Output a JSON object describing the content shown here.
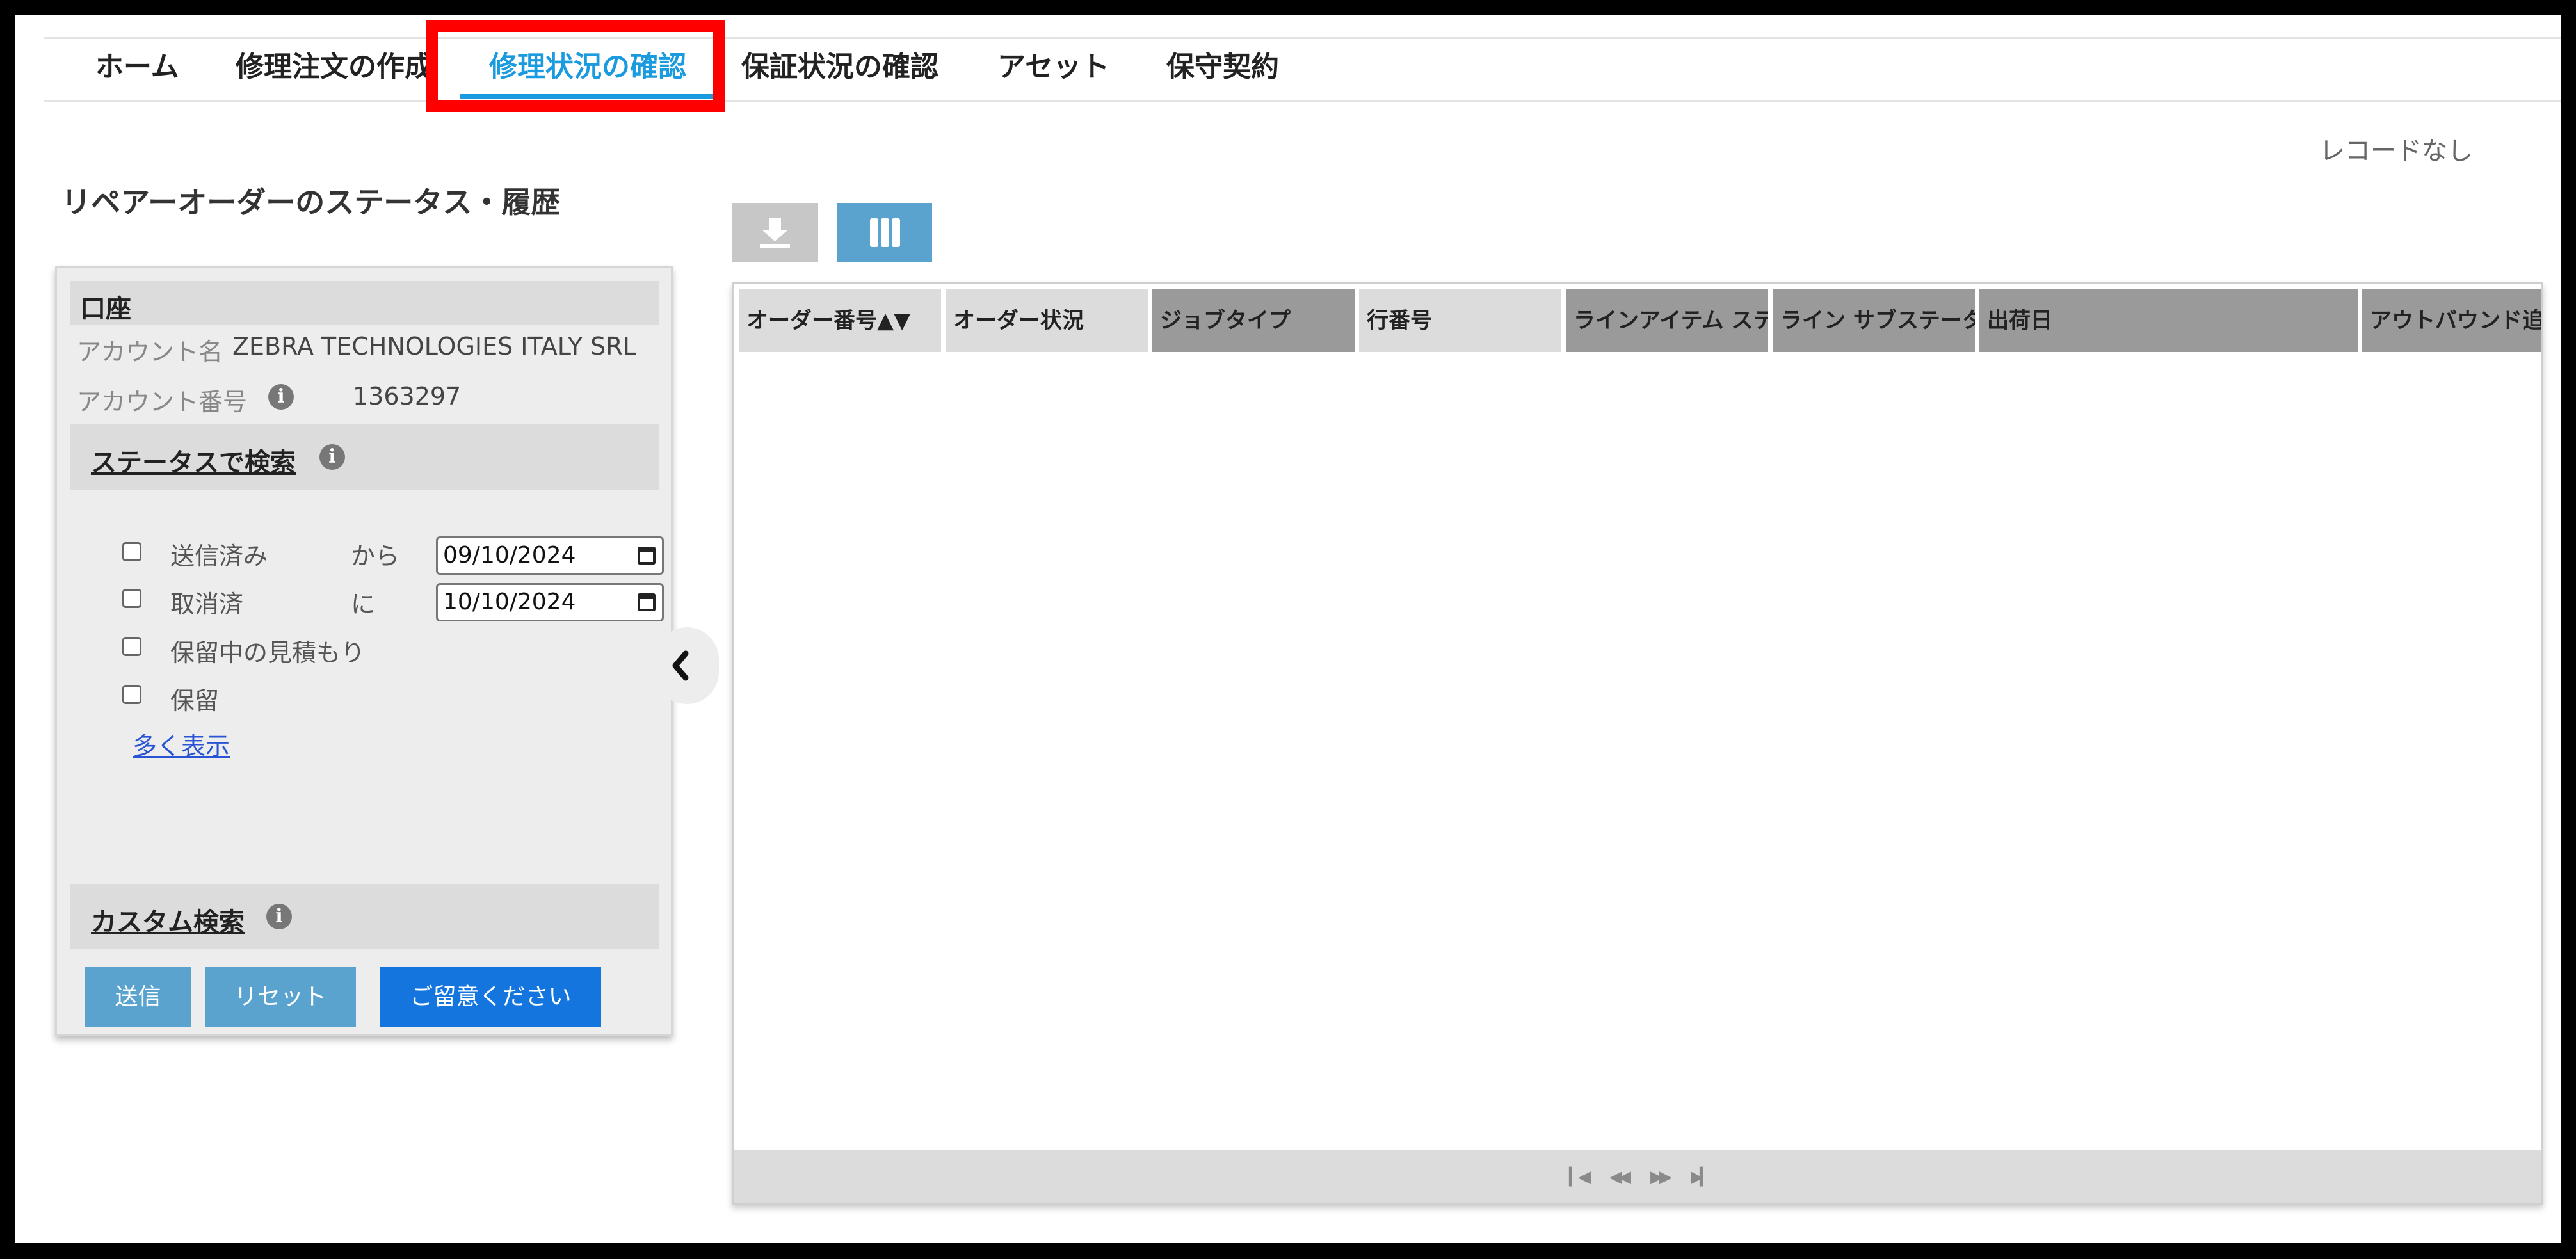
{
  "nav": {
    "items": [
      {
        "label": "ホーム"
      },
      {
        "label": "修理注文の作成"
      },
      {
        "label": "修理状況の確認",
        "active": true
      },
      {
        "label": "保証状況の確認"
      },
      {
        "label": "アセット"
      },
      {
        "label": "保守契約"
      }
    ]
  },
  "page": {
    "title": "リペアーオーダーのステータス・履歴",
    "record_count": "レコードなし"
  },
  "account": {
    "header": "口座",
    "name_label": "アカウント名",
    "name_value": "ZEBRA TECHNOLOGIES ITALY SRL",
    "number_label": "アカウント番号",
    "number_value": "1363297"
  },
  "status_search": {
    "header": "ステータスで検索",
    "checkboxes": [
      "送信済み",
      "取消済",
      "保留中の見積もり",
      "保留"
    ],
    "from_label": "から",
    "to_label": "に",
    "from_date": "09/10/2024",
    "to_date": "10/10/2024",
    "show_more": "多く表示"
  },
  "custom_search": {
    "header": "カスタム検索"
  },
  "buttons": {
    "submit": "送信",
    "reset": "リセット",
    "notice": "ご留意ください"
  },
  "grid": {
    "columns": [
      "オーダー番号▲▼",
      "オーダー状況",
      "ジョブタイプ",
      "行番号",
      "ラインアイテム ステ",
      "ライン サブステータ",
      "出荷日",
      "アウトバウンド追跡"
    ],
    "rows": []
  },
  "colors": {
    "accent": "#1a9be0",
    "highlight": "#ff0000",
    "button": "#5aa3cf",
    "button_primary": "#1575de"
  }
}
